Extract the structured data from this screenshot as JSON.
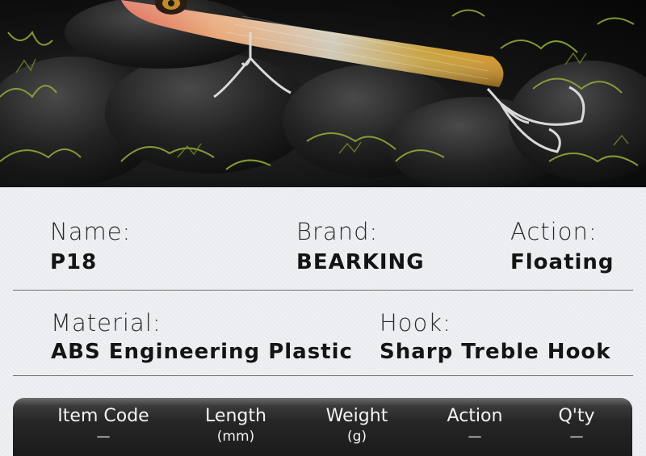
{
  "specs": {
    "name_label": "Name:",
    "name_value": "P18",
    "brand_label": "Brand:",
    "brand_value": "BEARKING",
    "action_label": "Action:",
    "action_value": "Floating",
    "material_label": "Material:",
    "material_value": "ABS Engineering Plastic",
    "hook_label": "Hook:",
    "hook_value": "Sharp Treble Hook"
  },
  "table": {
    "headers": [
      {
        "title": "Item Code",
        "sub": "—"
      },
      {
        "title": "Length",
        "sub": "(mm)"
      },
      {
        "title": "Weight",
        "sub": "(g)"
      },
      {
        "title": "Action",
        "sub": "—"
      },
      {
        "title": "Q'ty",
        "sub": "—"
      }
    ]
  },
  "colors": {
    "lure_head": "#e0523a",
    "lure_body": "#d89a2e",
    "moss": "#8fa83a"
  }
}
